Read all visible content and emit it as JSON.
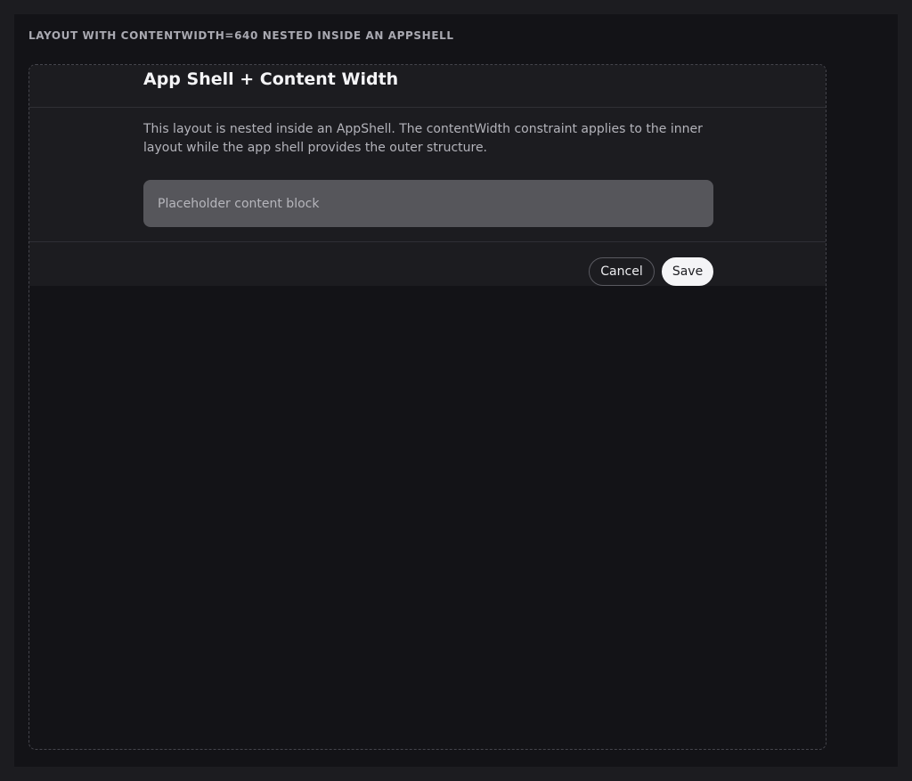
{
  "caption": "LAYOUT WITH CONTENTWIDTH=640 NESTED INSIDE AN APPSHELL",
  "layout": {
    "title": "App Shell + Content Width",
    "description": "This layout is nested inside an AppShell. The contentWidth constraint applies to the inner layout while the app shell provides the outer structure.",
    "placeholder_text": "Placeholder content block"
  },
  "footer": {
    "cancel_label": "Cancel",
    "save_label": "Save"
  }
}
